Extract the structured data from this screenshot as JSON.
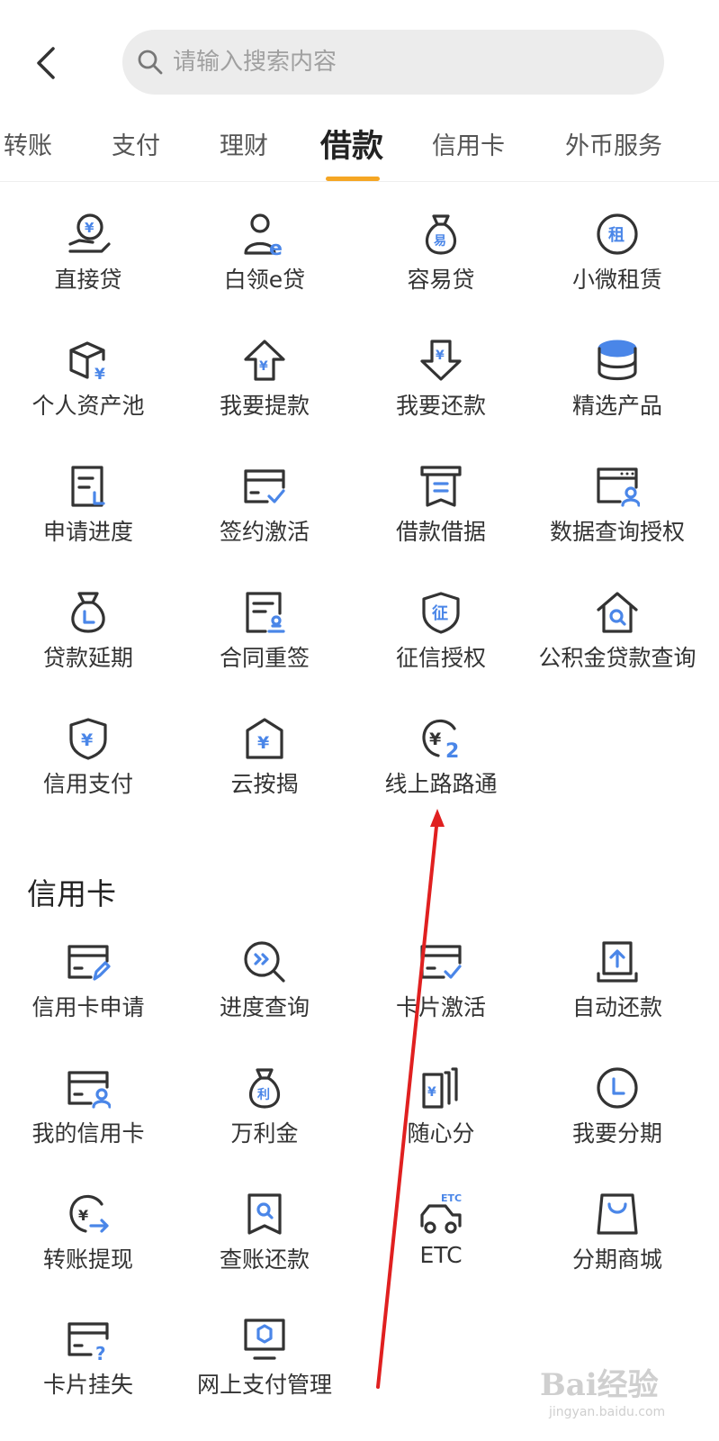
{
  "search": {
    "placeholder": "请输入搜索内容"
  },
  "tabs": [
    {
      "label": "转账"
    },
    {
      "label": "支付"
    },
    {
      "label": "理财"
    },
    {
      "label": "借款"
    },
    {
      "label": "信用卡"
    },
    {
      "label": "外币服务"
    }
  ],
  "active_tab": "借款",
  "loan_items": [
    {
      "label": "直接贷",
      "icon": "hand-yuan-icon"
    },
    {
      "label": "白领e贷",
      "icon": "person-e-icon"
    },
    {
      "label": "容易贷",
      "icon": "money-bag-yi-icon"
    },
    {
      "label": "小微租赁",
      "icon": "circle-zu-icon"
    },
    {
      "label": "个人资产池",
      "icon": "box-yuan-icon"
    },
    {
      "label": "我要提款",
      "icon": "arrow-up-yuan-icon"
    },
    {
      "label": "我要还款",
      "icon": "arrow-down-yuan-icon"
    },
    {
      "label": "精选产品",
      "icon": "stack-icon"
    },
    {
      "label": "申请进度",
      "icon": "document-l-icon"
    },
    {
      "label": "签约激活",
      "icon": "card-check-icon"
    },
    {
      "label": "借款借据",
      "icon": "receipt-icon"
    },
    {
      "label": "数据查询授权",
      "icon": "window-user-icon"
    },
    {
      "label": "贷款延期",
      "icon": "bag-clock-icon"
    },
    {
      "label": "合同重签",
      "icon": "contract-stamp-icon"
    },
    {
      "label": "征信授权",
      "icon": "shield-zheng-icon"
    },
    {
      "label": "公积金贷款查询",
      "icon": "house-search-icon"
    },
    {
      "label": "信用支付",
      "icon": "shield-yuan-icon"
    },
    {
      "label": "云按揭",
      "icon": "house-yuan-icon"
    },
    {
      "label": "线上路路通",
      "icon": "yuan-2-icon"
    }
  ],
  "credit_section": {
    "title": "信用卡"
  },
  "credit_items": [
    {
      "label": "信用卡申请",
      "icon": "card-pen-icon"
    },
    {
      "label": "进度查询",
      "icon": "search-forward-icon"
    },
    {
      "label": "卡片激活",
      "icon": "card-check-icon"
    },
    {
      "label": "自动还款",
      "icon": "upload-tray-icon"
    },
    {
      "label": "我的信用卡",
      "icon": "card-user-icon"
    },
    {
      "label": "万利金",
      "icon": "bag-li-icon"
    },
    {
      "label": "随心分",
      "icon": "cards-stack-icon"
    },
    {
      "label": "我要分期",
      "icon": "clock-icon"
    },
    {
      "label": "转账提现",
      "icon": "yuan-arrow-icon"
    },
    {
      "label": "查账还款",
      "icon": "bookmark-search-icon"
    },
    {
      "label": "ETC",
      "icon": "car-etc-icon"
    },
    {
      "label": "分期商城",
      "icon": "shopping-bag-icon"
    },
    {
      "label": "卡片挂失",
      "icon": "card-question-icon"
    },
    {
      "label": "网上支付管理",
      "icon": "monitor-icon"
    }
  ],
  "watermark": {
    "brand": "Bai经验",
    "url": "jingyan.baidu.com"
  },
  "colors": {
    "accent": "#f5a623",
    "icon_blue": "#4a86e8",
    "annotation": "#e02020"
  }
}
